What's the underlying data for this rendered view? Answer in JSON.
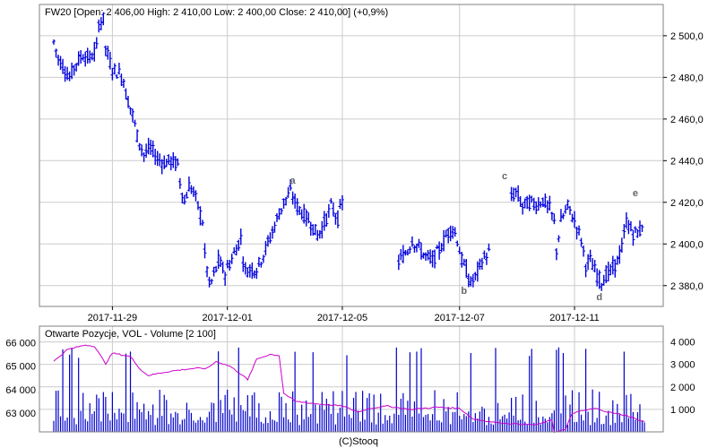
{
  "colors": {
    "price": "#0000dd",
    "oi": "#cc00cc",
    "volume": "#0000cc",
    "grid": "#cccccc",
    "frame": "#808080",
    "wave_label": "#666666"
  },
  "footer": "(C)Stooq",
  "chart_data": [
    {
      "type": "bar",
      "title": "FW20 [Open: 2 406,00  High: 2 410,00  Low: 2 400,00  Close: 2 410,00] (+0,9%)",
      "ylim": [
        2370,
        2515
      ],
      "y_ticks": [
        2380,
        2400,
        2420,
        2440,
        2460,
        2480,
        2500
      ],
      "y_tick_labels": [
        "2 380,0",
        "2 400,0",
        "2 420,0",
        "2 440,0",
        "2 460,0",
        "2 480,0",
        "2 500,0"
      ],
      "x_ticks": [
        "2017-11-29",
        "2017-12-01",
        "2017-12-05",
        "2017-12-07",
        "2017-12-11"
      ],
      "grid": true,
      "anchors": [
        [
          0,
          2497
        ],
        [
          2,
          2489
        ],
        [
          5,
          2484
        ],
        [
          7,
          2480
        ],
        [
          10,
          2487
        ],
        [
          13,
          2491
        ],
        [
          16,
          2489
        ],
        [
          19,
          2494
        ],
        [
          20,
          2506
        ],
        [
          22,
          2508
        ],
        [
          23,
          2494
        ],
        [
          26,
          2484
        ],
        [
          29,
          2482
        ],
        [
          31,
          2479
        ],
        [
          32,
          2472
        ],
        [
          35,
          2462
        ],
        [
          37,
          2452
        ],
        [
          40,
          2443
        ],
        [
          43,
          2446
        ],
        [
          46,
          2441
        ],
        [
          49,
          2439
        ],
        [
          52,
          2440
        ],
        [
          55,
          2438
        ],
        [
          56,
          2430
        ],
        [
          58,
          2420
        ],
        [
          60,
          2428
        ],
        [
          62,
          2425
        ],
        [
          64,
          2418
        ],
        [
          66,
          2411
        ],
        [
          67,
          2395
        ],
        [
          68,
          2388
        ],
        [
          69,
          2380
        ],
        [
          70,
          2382
        ],
        [
          72,
          2388
        ],
        [
          73,
          2392
        ],
        [
          74,
          2390
        ],
        [
          76,
          2386
        ],
        [
          79,
          2393
        ],
        [
          81,
          2398
        ],
        [
          83,
          2403
        ],
        [
          84,
          2393
        ],
        [
          85,
          2387
        ],
        [
          87,
          2388
        ],
        [
          90,
          2388
        ],
        [
          93,
          2395
        ],
        [
          96,
          2403
        ],
        [
          99,
          2412
        ],
        [
          102,
          2420
        ],
        [
          105,
          2425
        ],
        [
          108,
          2418
        ],
        [
          111,
          2414
        ],
        [
          114,
          2410
        ],
        [
          117,
          2404
        ],
        [
          120,
          2410
        ],
        [
          123,
          2418
        ],
        [
          126,
          2412
        ],
        [
          128,
          2420
        ],
        [
          130,
          null
        ],
        [
          150,
          null
        ],
        [
          152,
          2390
        ],
        [
          154,
          2393
        ],
        [
          157,
          2397
        ],
        [
          159,
          2402
        ],
        [
          162,
          2398
        ],
        [
          165,
          2394
        ],
        [
          168,
          2392
        ],
        [
          171,
          2397
        ],
        [
          174,
          2404
        ],
        [
          177,
          2408
        ],
        [
          179,
          2402
        ],
        [
          181,
          2392
        ],
        [
          183,
          2387
        ],
        [
          185,
          2381
        ],
        [
          187,
          2384
        ],
        [
          190,
          2392
        ],
        [
          193,
          2396
        ],
        [
          194,
          null
        ],
        [
          201,
          null
        ],
        [
          202,
          2421
        ],
        [
          205,
          2425
        ],
        [
          208,
          2418
        ],
        [
          211,
          2420
        ],
        [
          214,
          2419
        ],
        [
          217,
          2421
        ],
        [
          220,
          2417
        ],
        [
          222,
          2410
        ],
        [
          223,
          2397
        ],
        [
          225,
          2411
        ],
        [
          228,
          2418
        ],
        [
          231,
          2411
        ],
        [
          234,
          2402
        ],
        [
          236,
          2390
        ],
        [
          238,
          2392
        ],
        [
          241,
          2385
        ],
        [
          243,
          2382
        ],
        [
          245,
          2385
        ],
        [
          248,
          2388
        ],
        [
          250,
          2392
        ],
        [
          252,
          2398
        ],
        [
          254,
          2411
        ],
        [
          257,
          2405
        ],
        [
          260,
          2406
        ],
        [
          261,
          2410
        ]
      ],
      "wave_labels": [
        {
          "text": "a",
          "x": 106,
          "y": 2429
        },
        {
          "text": "b",
          "x": 182,
          "y": 2376
        },
        {
          "text": "c",
          "x": 200,
          "y": 2431
        },
        {
          "text": "d",
          "x": 242,
          "y": 2373
        },
        {
          "text": "e",
          "x": 258,
          "y": 2423
        }
      ]
    },
    {
      "type": "bar",
      "title": "Otwarte Pozycje, VOL - Volume [2 100]",
      "series": [
        {
          "name": "Otwarte Pozycje",
          "type": "line",
          "axis": "left",
          "anchors": [
            [
              0,
              65200
            ],
            [
              6,
              65700
            ],
            [
              14,
              65900
            ],
            [
              18,
              65850
            ],
            [
              23,
              65100
            ],
            [
              26,
              65550
            ],
            [
              29,
              65500
            ],
            [
              34,
              65400
            ],
            [
              39,
              64800
            ],
            [
              42,
              64600
            ],
            [
              47,
              64700
            ],
            [
              53,
              64800
            ],
            [
              62,
              64900
            ],
            [
              68,
              64900
            ],
            [
              72,
              65200
            ],
            [
              78,
              65000
            ],
            [
              84,
              64600
            ],
            [
              86,
              64400
            ],
            [
              90,
              65300
            ],
            [
              96,
              65500
            ],
            [
              100,
              65450
            ],
            [
              102,
              63850
            ],
            [
              107,
              63500
            ],
            [
              116,
              63400
            ],
            [
              128,
              63300
            ],
            [
              135,
              63050
            ],
            [
              140,
              63200
            ],
            [
              148,
              63300
            ],
            [
              158,
              63150
            ],
            [
              170,
              63250
            ],
            [
              180,
              63200
            ],
            [
              186,
              62750
            ],
            [
              196,
              62600
            ],
            [
              203,
              62550
            ],
            [
              214,
              62500
            ],
            [
              221,
              62700
            ],
            [
              222,
              62200
            ],
            [
              227,
              62300
            ],
            [
              230,
              63000
            ],
            [
              240,
              63200
            ],
            [
              248,
              63000
            ],
            [
              254,
              62900
            ],
            [
              261,
              62650
            ]
          ]
        },
        {
          "name": "VOL - Volume",
          "type": "bar",
          "axis": "right",
          "max": 4600
        }
      ],
      "left_ylim": [
        62200,
        66700
      ],
      "left_ticks": [
        63000,
        64000,
        65000,
        66000
      ],
      "left_tick_labels": [
        "63 000",
        "64 000",
        "65 000",
        "66 000"
      ],
      "right_ylim": [
        0,
        4700
      ],
      "right_ticks": [
        1000,
        2000,
        3000,
        4000
      ],
      "right_tick_labels": [
        "1 000",
        "2 000",
        "3 000",
        "4 000"
      ],
      "grid": true
    }
  ]
}
